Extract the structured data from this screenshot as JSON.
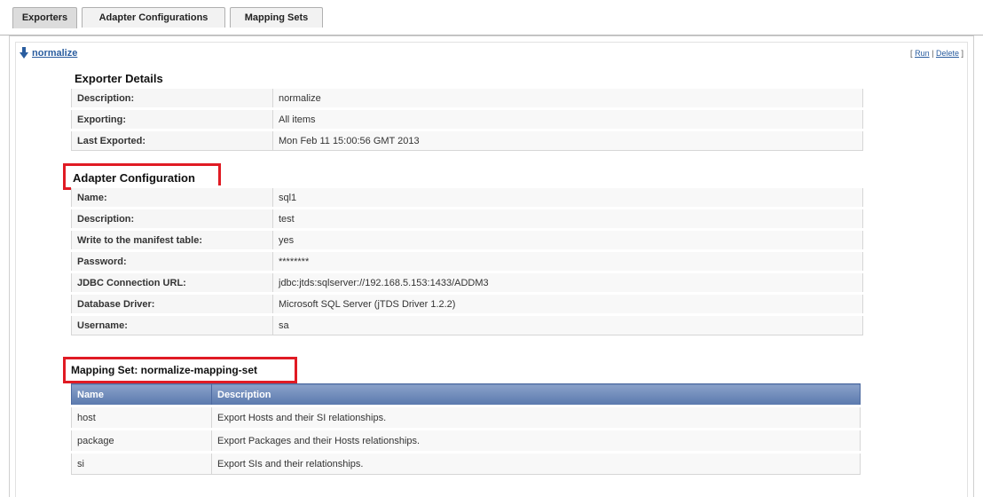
{
  "tabs": [
    {
      "label": "Exporters",
      "active": true
    },
    {
      "label": "Adapter Configurations",
      "active": false
    },
    {
      "label": "Mapping Sets",
      "active": false
    }
  ],
  "exporter": {
    "name": "normalize",
    "actions": {
      "open": "[",
      "run": "Run",
      "sep": "|",
      "delete": "Delete",
      "close": "]"
    }
  },
  "exporter_details": {
    "title": "Exporter Details",
    "rows": [
      {
        "label": "Description:",
        "value": "normalize"
      },
      {
        "label": "Exporting:",
        "value": "All items"
      },
      {
        "label": "Last Exported:",
        "value": "Mon Feb 11 15:00:56 GMT 2013"
      }
    ]
  },
  "adapter_configuration": {
    "title": "Adapter Configuration",
    "rows": [
      {
        "label": "Name:",
        "value": "sql1"
      },
      {
        "label": "Description:",
        "value": "test"
      },
      {
        "label": "Write to the manifest table:",
        "value": "yes"
      },
      {
        "label": "Password:",
        "value": "********"
      },
      {
        "label": "JDBC Connection URL:",
        "value": "jdbc:jtds:sqlserver://192.168.5.153:1433/ADDM3"
      },
      {
        "label": "Database Driver:",
        "value": "Microsoft SQL Server (jTDS Driver 1.2.2)"
      },
      {
        "label": "Username:",
        "value": "sa"
      }
    ]
  },
  "mapping_set": {
    "title": "Mapping Set: normalize-mapping-set",
    "columns": [
      "Name",
      "Description"
    ],
    "rows": [
      {
        "name": "host",
        "description": "Export Hosts and their SI relationships."
      },
      {
        "name": "package",
        "description": "Export Packages and their Hosts relationships."
      },
      {
        "name": "si",
        "description": "Export SIs and their relationships."
      }
    ]
  },
  "colors": {
    "highlight": "#e01b24",
    "link": "#2a5d9f",
    "table_header": "#5a79ad"
  }
}
